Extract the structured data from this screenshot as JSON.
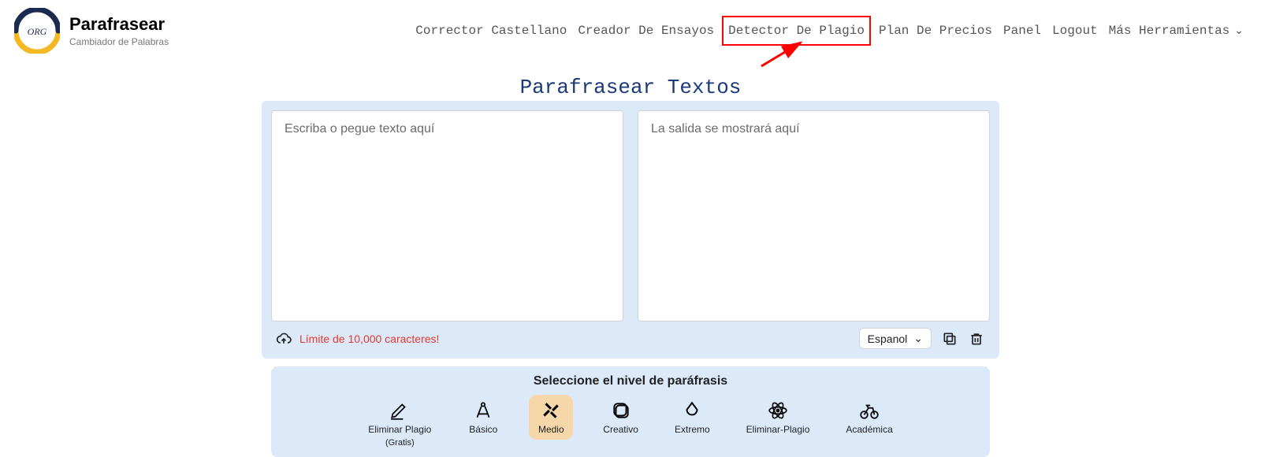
{
  "header": {
    "logo_title": "Parafrasear",
    "logo_subtitle": "Cambiador de Palabras",
    "logo_badge": "ORG"
  },
  "nav": {
    "items": [
      "Corrector Castellano",
      "Creador De Ensayos",
      "Detector De Plagio",
      "Plan De Precios",
      "Panel",
      "Logout",
      "Más Herramientas"
    ],
    "highlighted_index": 2
  },
  "page_title": "Parafrasear Textos",
  "tool": {
    "input_placeholder": "Escriba o pegue texto aquí",
    "output_placeholder": "La salida se mostrará aquí",
    "limit_text": "Límite de 10,000 caracteres!",
    "language_selected": "Espanol"
  },
  "levels": {
    "title": "Seleccione el nivel de paráfrasis",
    "items": [
      {
        "label": "Eliminar Plagio",
        "sub": "(Gratis)"
      },
      {
        "label": "Básico"
      },
      {
        "label": "Medio"
      },
      {
        "label": "Creativo"
      },
      {
        "label": "Extremo"
      },
      {
        "label": "Eliminar-Plagio"
      },
      {
        "label": "Académica"
      }
    ],
    "active_index": 2
  }
}
